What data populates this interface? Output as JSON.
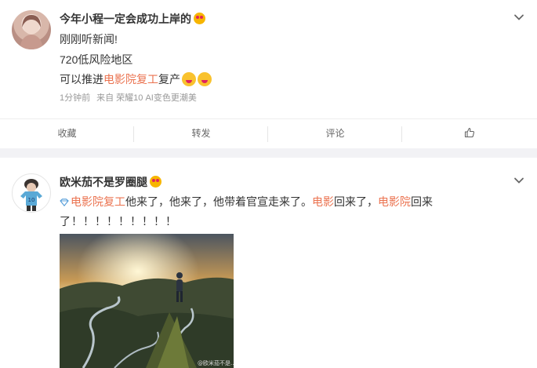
{
  "post1": {
    "username": "今年小程一定会成功上岸的",
    "lines": [
      "刚刚听新闻!",
      "720低风险地区"
    ],
    "line3_prefix": "可以推进",
    "line3_tag": "电影院复工",
    "line3_suffix": "复产",
    "meta": {
      "time": "1分钟前",
      "source": "来自 荣耀10 AI变色更潮美"
    },
    "actions": {
      "collect": "收藏",
      "repost": "转发",
      "comment": "评论"
    }
  },
  "post2": {
    "username": "欧米茄不是罗圈腿",
    "text": {
      "tag1": "电影院复工",
      "seg1": "他来了，他来了，他带着官宣走来了。",
      "tag2": "电影",
      "seg2": "回来了，",
      "tag3": "电影院",
      "seg3": "回来",
      "line2": "了！！！！！！！！！"
    },
    "image_watermark": "@欧米茄不是..."
  },
  "colors": {
    "tag": "#eb7350",
    "meta": "#999999",
    "text": "#333333"
  },
  "icons": [
    "chevron-down-icon",
    "thumb-up-icon",
    "diamond-icon",
    "heart-eyes-emoji",
    "yum-emoji"
  ]
}
